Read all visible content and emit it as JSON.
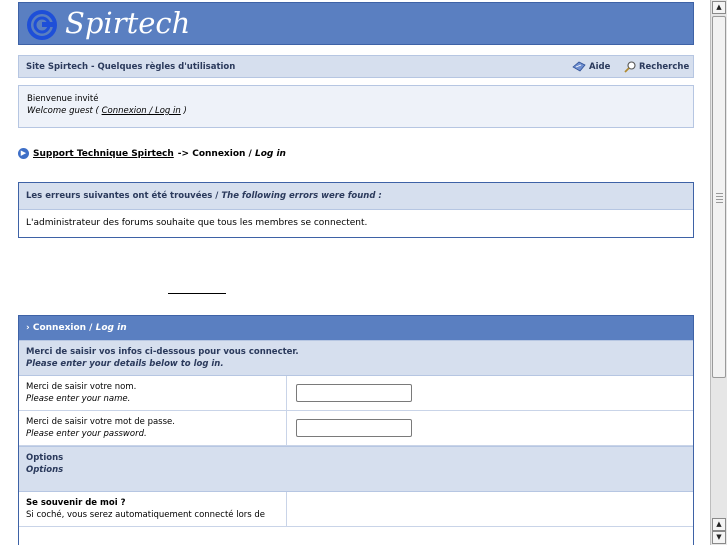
{
  "header": {
    "site_name": "Spirtech",
    "brand_color": "#5a7fc1"
  },
  "nav": {
    "title": "Site Spirtech - Quelques règles d'utilisation",
    "help_label": "Aide",
    "search_label": "Recherche"
  },
  "welcome": {
    "line1": "Bienvenue invité",
    "line2_prefix": "Welcome guest ( ",
    "login_fr": "Connexion",
    "login_sep": " / ",
    "login_en": "Log in",
    "line2_suffix": " )"
  },
  "breadcrumb": {
    "forum_link": "Support Technique Spirtech",
    "arrow": " -> ",
    "current_fr": "Connexion / ",
    "current_en": "Log in"
  },
  "errors": {
    "heading_fr": "Les erreurs suivantes ont été trouvées / ",
    "heading_en": "The following errors were found :",
    "message": "L'administrateur des forums souhaite que tous les membres se connectent."
  },
  "login": {
    "heading_fr": "Connexion / ",
    "heading_en": "Log in",
    "intro_fr": "Merci de saisir vos infos ci-dessous pour vous connecter.",
    "intro_en": "Please enter your details below to log in.",
    "name_label_fr": "Merci de saisir votre nom.",
    "name_label_en": "Please enter your name.",
    "name_value": "",
    "password_label_fr": "Merci de saisir votre mot de passe.",
    "password_label_en": "Please enter your password.",
    "password_value": "",
    "options_fr": "Options",
    "options_en": "Options",
    "remember_title": "Se souvenir de moi ?",
    "remember_desc": "Si coché, vous serez automatiquement connecté lors de"
  }
}
